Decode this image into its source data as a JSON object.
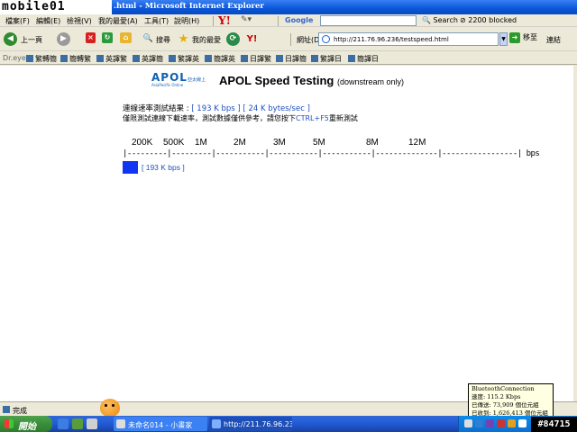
{
  "window": {
    "watermark": "mobile01",
    "title": ".html - Microsoft Internet Explorer"
  },
  "menu": {
    "items": [
      "檔案(F)",
      "編輯(E)",
      "檢視(V)",
      "我的最愛(A)",
      "工具(T)",
      "說明(H)"
    ],
    "google_label": "Google",
    "search_label": "Search",
    "blocked_label": "2200 blocked"
  },
  "toolbar": {
    "back_label": "上一頁",
    "search_label": "搜尋",
    "favorites_label": "我的最愛",
    "address_label": "網址(D)",
    "address_value": "http://211.76.96.236/testspeed.html",
    "go_label": "移至",
    "links_label": "連結"
  },
  "dreye": {
    "label": "Dr.eye",
    "items": [
      "繁轉簡",
      "簡轉繁",
      "英譯繁",
      "英譯簡",
      "繁譯英",
      "簡譯英",
      "日譯繁",
      "日譯簡",
      "繁譯日",
      "簡譯日"
    ]
  },
  "page": {
    "logo_text": "APOL",
    "logo_sub": "AsiaPacific Online",
    "logo_cn": "亞太線上",
    "title": "APOL Speed Testing",
    "subtitle": "(downstream only)",
    "result_prefix": "連線速率測試結果 : ",
    "result_kbps": "[ 193 K bps ]",
    "result_kbytes": "[ 24 K bytes/sec ]",
    "note_prefix": "僅限測試連線下載速率，測試數據僅供參考，請您按下",
    "note_key": "CTRL+F5",
    "note_suffix": "重新測試",
    "scale_ticks": [
      "200K",
      "500K",
      "1M",
      "2M",
      "3M",
      "5M",
      "8M",
      "12M"
    ],
    "scale_line": "|---------|---------|-----------|-----------|-----------|--------------|-----------------| bps",
    "bar_label": "[ 193 K bps ]",
    "bar_value_kbps": 193
  },
  "status": {
    "text": "完成"
  },
  "taskbar": {
    "start_label": "開始",
    "tasks": [
      "未命名014 - 小畫家",
      "http://211.76.96.236/te..."
    ],
    "clock": "#84715"
  },
  "tooltip": {
    "title": "BluetoothConnection",
    "speed": "速度: 115.2 Kbps",
    "sent": "已傳送: 73,909 個位元組",
    "received": "已收到: 1,626,413 個位元組"
  },
  "colors": {
    "link_blue": "#2050c0",
    "bar_blue": "#1036f2",
    "titlebar_blue": "#0a56d8"
  }
}
